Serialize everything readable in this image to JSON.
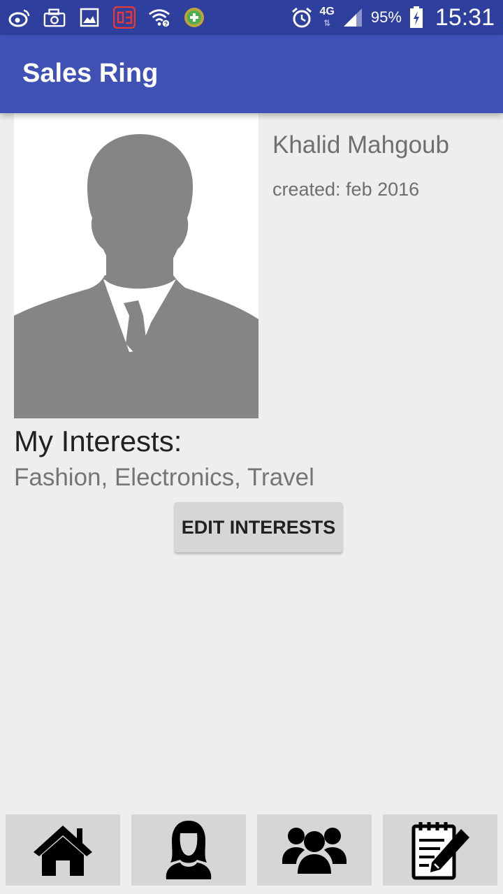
{
  "status_bar": {
    "network": "4G",
    "battery": "95%",
    "time": "15:31",
    "icons": [
      "weibo-icon",
      "camera-icon",
      "gallery-icon",
      "app-icon",
      "wifi-icon",
      "plus-app-icon",
      "alarm-icon",
      "signal-icon",
      "battery-icon"
    ]
  },
  "app_bar": {
    "title": "Sales Ring"
  },
  "profile": {
    "name": "Khalid Mahgoub",
    "created": "created: feb 2016",
    "avatar": "person-silhouette-icon"
  },
  "interests": {
    "heading": "My Interests:",
    "list": "Fashion, Electronics, Travel",
    "edit_label": "EDIT INTERESTS"
  },
  "bottom_nav": [
    {
      "icon": "home-icon"
    },
    {
      "icon": "profile-icon"
    },
    {
      "icon": "group-icon"
    },
    {
      "icon": "notes-edit-icon"
    }
  ]
}
